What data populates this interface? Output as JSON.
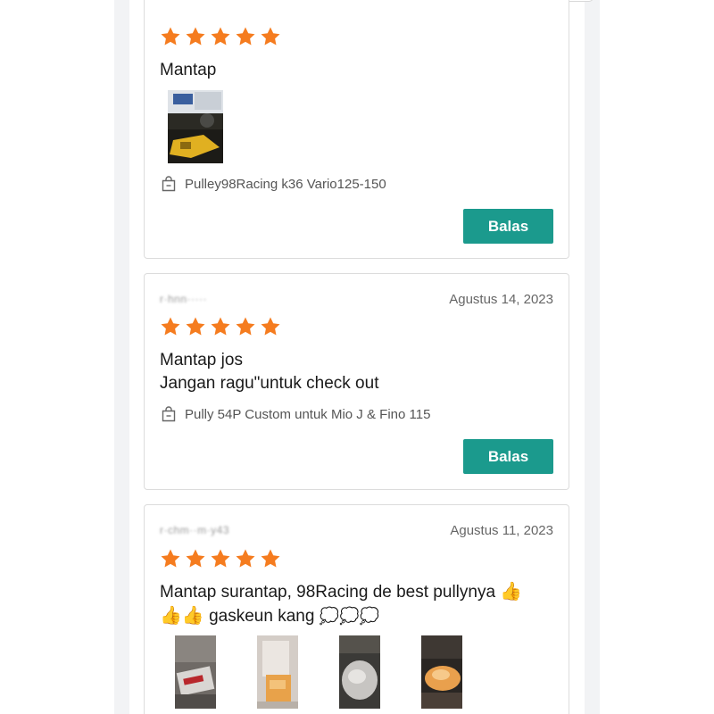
{
  "reviews": [
    {
      "reviewer": "",
      "date": "",
      "rating": 5,
      "text_lines": [
        "Mantap"
      ],
      "product": "Pulley98Racing k36 Vario125-150",
      "reply_label": "Balas",
      "photo_count": 1
    },
    {
      "reviewer": "r·hnn·····",
      "date": "Agustus 14, 2023",
      "rating": 5,
      "text_lines": [
        "Mantap jos",
        "Jangan ragu\"untuk check out"
      ],
      "product": "Pully 54P Custom untuk Mio J & Fino 115",
      "reply_label": "Balas",
      "photo_count": 0
    },
    {
      "reviewer": "r·chm··m·y43",
      "date": "Agustus 11, 2023",
      "rating": 5,
      "text_line1": "Mantap surantap, 98Racing de best pullynya",
      "text_line2": "gaskeun kang",
      "emoji_thumb": "👍",
      "emoji_burst": "💭",
      "photo_count": 4
    }
  ],
  "colors": {
    "star": "#f57c1f",
    "reply_button": "#1b9a8d",
    "card_border": "#dcdcdc"
  },
  "icons": {
    "star": "star-icon",
    "product": "shopping-bag-icon"
  }
}
